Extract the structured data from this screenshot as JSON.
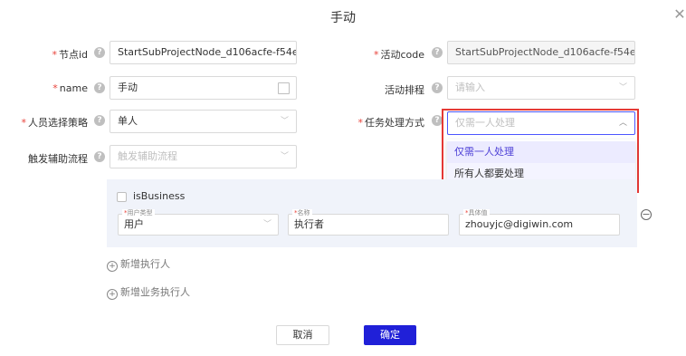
{
  "dialog": {
    "title": "手动",
    "close_icon": "close-icon"
  },
  "left_fields": {
    "node_id": {
      "label": "节点id",
      "value": "StartSubProjectNode_d106acfe-f54e..."
    },
    "name": {
      "label": "name",
      "value": "手动"
    },
    "strategy": {
      "label": "人员选择策略",
      "value": "单人"
    },
    "trigger_flow": {
      "label": "触发辅助流程",
      "placeholder": "触发辅助流程"
    }
  },
  "right_fields": {
    "activity_code": {
      "label": "活动code",
      "value": "StartSubProjectNode_d106acfe-f54e..."
    },
    "activity_schedule": {
      "label": "活动排程",
      "placeholder": "请输入"
    },
    "task_mode": {
      "label": "任务处理方式",
      "placeholder": "仅需一人处理"
    }
  },
  "task_mode_options": [
    "仅需一人处理",
    "所有人都要处理"
  ],
  "executor": {
    "is_business_label": "isBusiness",
    "user_type": {
      "label": "用户类型",
      "value": "用户"
    },
    "name": {
      "label": "名称",
      "value": "执行者"
    },
    "specific_value": {
      "label": "具体值",
      "value": "zhouyjc@digiwin.com"
    }
  },
  "links": {
    "add_executor": "新增执行人",
    "add_business_executor": "新增业务执行人"
  },
  "buttons": {
    "cancel": "取消",
    "ok": "确定"
  },
  "colors": {
    "primary": "#2020d8",
    "required": "#e8423a",
    "highlight_border": "#e53935"
  }
}
